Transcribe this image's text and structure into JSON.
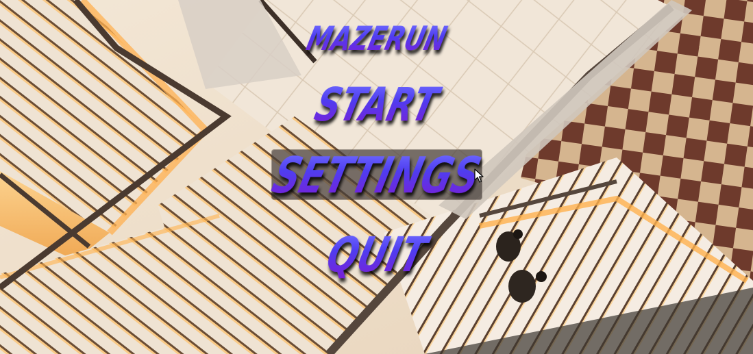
{
  "title": "MAZERUN",
  "menu": {
    "start_label": "START",
    "settings_label": "SETTINGS",
    "quit_label": "QUIT"
  },
  "hovered_item": "settings",
  "colors": {
    "text_top": "#6f6bff",
    "text_mid": "#4f3df0",
    "text_bottom": "#7a1fd6",
    "hover_highlight": "#463e3a"
  },
  "background": "staircase-atrium-photo",
  "cursor_icon": "arrow-pointer-icon"
}
